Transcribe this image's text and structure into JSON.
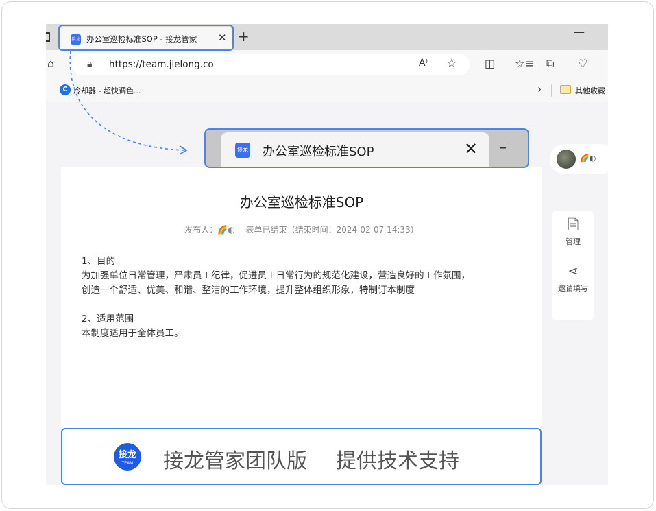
{
  "browser": {
    "tab_title": "办公室巡检标准SOP - 接龙管家",
    "tab_favicon_text": "接龙",
    "url": "https://team.jielong.co",
    "bookmark_1": "冷却器 - 超快调色...",
    "bookmark_other": "其他收藏"
  },
  "zoom_callout": {
    "favicon_text": "接龙",
    "tab_title": "办公室巡检标准SOP"
  },
  "document": {
    "title": "办公室巡检标准SOP",
    "publisher_label": "发布人：",
    "publisher_name": "🌈◐",
    "status": "表单已结束（结束时间：2024-02-07 14:33）",
    "section1_heading": "1、目的",
    "section1_line1": "为加强单位日常管理，严肃员工纪律，促进员工日常行为的规范化建设，营造良好的工作氛围，",
    "section1_line2": "创造一个舒适、优美、和谐、整洁的工作环境，提升整体组织形象，特制订本制度",
    "section2_heading": "2、适用范围",
    "section2_body": "本制度适用于全体员工。"
  },
  "user": {
    "name": "🌈◐"
  },
  "side_panel": {
    "manage_label": "管理",
    "invite_label": "邀请填写"
  },
  "footer": {
    "logo_line1": "接龙",
    "logo_line2": "TEAM",
    "brand": "接龙管家团队版",
    "support": "提供技术支持"
  },
  "colors": {
    "accent": "#4a86e8",
    "brand_blue": "#1f5be8"
  }
}
